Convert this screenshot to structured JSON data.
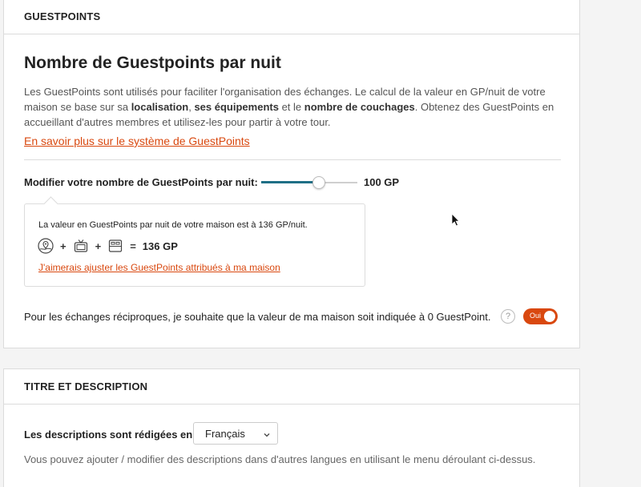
{
  "guestpoints_card": {
    "header": "GUESTPOINTS",
    "title": "Nombre de Guestpoints par nuit",
    "desc_part1": "Les GuestPoints sont utilisés pour faciliter l'organisation des échanges. Le calcul de la valeur en GP/nuit de votre maison se base sur sa ",
    "desc_bold1": "localisation",
    "desc_part2": ", ",
    "desc_bold2": "ses équipements",
    "desc_part3": " et le ",
    "desc_bold3": "nombre de couchages",
    "desc_part4": ". Obtenez des GuestPoints en accueillant d'autres membres et utilisez-les pour partir à votre tour.",
    "learn_more_link": "En savoir plus sur le système de GuestPoints",
    "modify_label": "Modifier votre nombre de GuestPoints par nuit:",
    "slider_fraction": 0.6,
    "slider_value": "100 GP",
    "info_text": "La valeur en GuestPoints par nuit de votre maison est à 136 GP/nuit.",
    "formula": {
      "icons": [
        "location-icon",
        "tv-icon",
        "bed-icon"
      ],
      "plus": "+",
      "equals": "=",
      "total": "136 GP"
    },
    "adjust_link": "J'aimerais ajuster les GuestPoints attribués à ma maison",
    "reciprocal_text": "Pour les échanges réciproques, je souhaite que la valeur de ma maison soit indiquée à 0 GuestPoint.",
    "help_symbol": "?",
    "toggle_label": "Oui",
    "accent_color": "#d9480f",
    "slider_color": "#1f6f86"
  },
  "title_card": {
    "header": "TITRE ET DESCRIPTION",
    "lang_label": "Les descriptions sont rédigées en :",
    "lang_selected": "Français",
    "lang_help": "Vous pouvez ajouter / modifier des descriptions dans d'autres langues en utilisant le menu déroulant ci-dessus."
  }
}
